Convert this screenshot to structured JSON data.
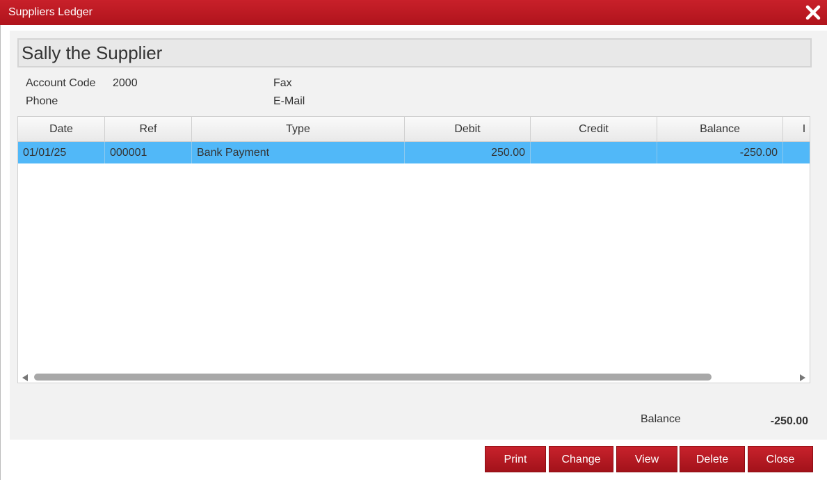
{
  "window": {
    "title": "Suppliers Ledger"
  },
  "supplier": {
    "name": "Sally the Supplier",
    "account_code_label": "Account Code",
    "account_code": "2000",
    "phone_label": "Phone",
    "phone": "",
    "fax_label": "Fax",
    "fax": "",
    "email_label": "E-Mail",
    "email": ""
  },
  "table": {
    "headers": [
      "Date",
      "Ref",
      "Type",
      "Debit",
      "Credit",
      "Balance",
      "I"
    ],
    "rows": [
      {
        "date": "01/01/25",
        "ref": "000001",
        "type": "Bank Payment",
        "debit": "250.00",
        "credit": "",
        "balance": "-250.00"
      }
    ]
  },
  "summary": {
    "balance_label": "Balance",
    "balance_value": "-250.00"
  },
  "buttons": {
    "print": "Print",
    "change": "Change",
    "view": "View",
    "delete": "Delete",
    "close": "Close"
  },
  "colors": {
    "titlebar": "#c0171f",
    "selected_row": "#51b8f8",
    "button": "#b5161e"
  }
}
